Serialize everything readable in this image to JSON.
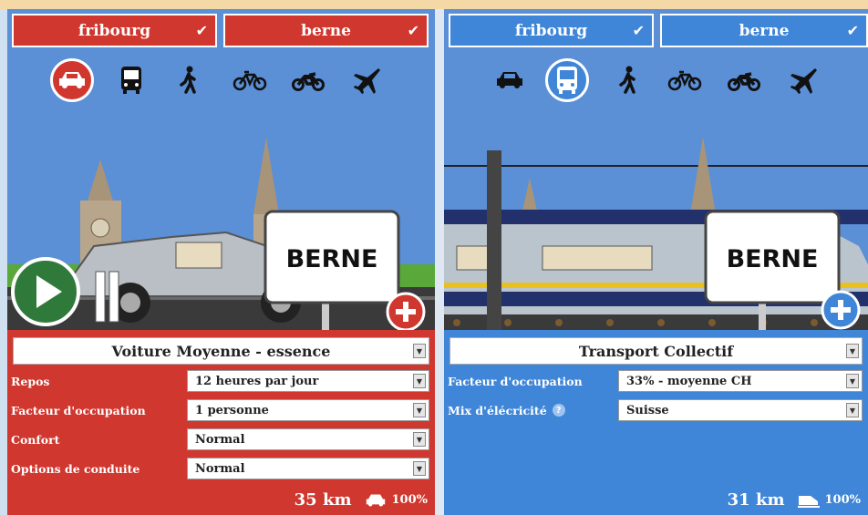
{
  "left": {
    "from_city": "fribourg",
    "to_city": "berne",
    "check": "✔",
    "sign": "BERNE",
    "vehicle": "Voiture Moyenne - essence",
    "options": [
      {
        "label": "Repos",
        "value": "12 heures par jour"
      },
      {
        "label": "Facteur d'occupation",
        "value": "1 personne"
      },
      {
        "label": "Confort",
        "value": "Normal"
      },
      {
        "label": "Options de conduite",
        "value": "Normal"
      }
    ],
    "distance": "35 km",
    "percent": "100%"
  },
  "right": {
    "from_city": "fribourg",
    "to_city": "berne",
    "check": "✔",
    "sign": "BERNE",
    "vehicle": "Transport Collectif",
    "options": [
      {
        "label": "Facteur d'occupation",
        "value": "33% - moyenne CH"
      },
      {
        "label": "Mix d'élécricité",
        "value": "Suisse"
      }
    ],
    "distance": "31 km",
    "percent": "100%"
  },
  "icons": [
    "car-icon",
    "bus-icon",
    "walk-icon",
    "bicycle-icon",
    "motorcycle-icon",
    "plane-icon",
    "play-icon",
    "add-icon",
    "help-icon"
  ],
  "colors": {
    "red": "#d0372f",
    "blue": "#3f86d8",
    "sky": "#5b8fd6",
    "grass": "#5aa83a"
  }
}
